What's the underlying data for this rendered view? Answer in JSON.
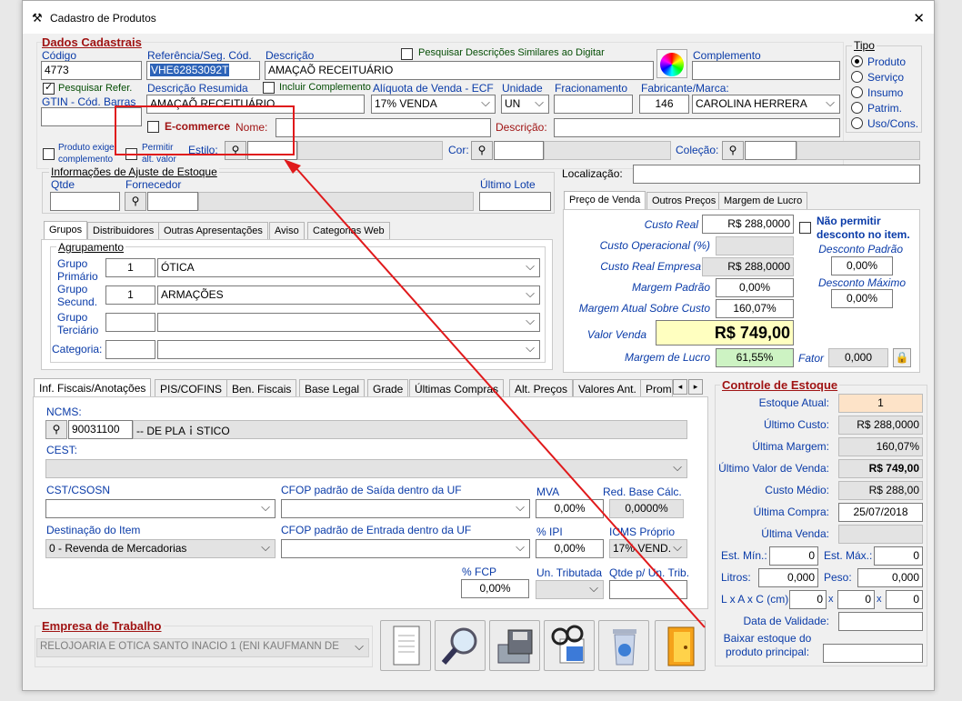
{
  "window": {
    "title": "Cadastro de Produtos",
    "close": "✕"
  },
  "dados": {
    "heading": "Dados Cadastrais",
    "codigo_label": "Código",
    "codigo": "4773",
    "ref_label": "Referência/Seg. Cód.",
    "ref": "VHE62853092T",
    "desc_label": "Descrição",
    "desc": "AMAÇAÕ RECEITUÁRIO",
    "pesq_label": "Pesquisar Descrições Similares ao Digitar",
    "compl_label": "Complemento",
    "compl": "",
    "pesqref_label": "Pesquisar Refer.",
    "gtin_label": "GTIN - Cód. Barras",
    "gtin": "",
    "descres_label": "Descrição Resumida",
    "descres": "AMAÇAÕ RECEITUÁRIO",
    "inclcompl_label": "Incluir Complemento",
    "aliq_label": "Alíquota de Venda - ECF",
    "aliq": "17% VENDA",
    "unid_label": "Unidade",
    "unid": "UN",
    "frac_label": "Fracionamento",
    "frac": "",
    "fab_label": "Fabricante/Marca:",
    "fab_code": "146",
    "fab": "CAROLINA HERRERA",
    "ecom_label": "E-commerce",
    "nome_label": "Nome:",
    "nome": "",
    "desc2_label": "Descrição:",
    "desc2": "",
    "prodexige_label": "Produto exige complemento",
    "permitir_label": "Permitir alt. valor",
    "estilo_label": "Estilo:",
    "cor_label": "Cor:",
    "colecao_label": "Coleção:",
    "tipo_label": "Tipo",
    "tipos": [
      "Produto",
      "Serviço",
      "Insumo",
      "Patrim.",
      "Uso/Cons."
    ],
    "localizacao_label": "Localização:",
    "localizacao": ""
  },
  "ajuste": {
    "heading": "Informações de Ajuste de Estoque",
    "qtde_label": "Qtde",
    "forn_label": "Fornecedor",
    "lote_label": "Último Lote"
  },
  "grupos": {
    "tabs": [
      "Grupos",
      "Distribuidores",
      "Outras Apresentações",
      "Aviso",
      "Categorias Web"
    ],
    "agrup_label": "Agrupamento",
    "primario_label": "Grupo Primário",
    "primario_code": "1",
    "primario": "ÓTICA",
    "secund_label": "Grupo Secund.",
    "secund_code": "1",
    "secund": "ARMAÇÕES",
    "terciario_label": "Grupo Terciário",
    "categoria_label": "Categoria:"
  },
  "preco": {
    "tabs": [
      "Preço de Venda",
      "Outros Preços",
      "Margem de Lucro"
    ],
    "custo_real_label": "Custo Real",
    "custo_real": "R$ 288,0000",
    "custo_op_label": "Custo Operacional (%)",
    "custo_op": "",
    "custo_emp_label": "Custo Real Empresa",
    "custo_emp": "R$ 288,0000",
    "margem_pad_label": "Margem Padrão",
    "margem_pad": "0,00%",
    "margem_atual_label": "Margem Atual Sobre Custo",
    "margem_atual": "160,07%",
    "valor_venda_label": "Valor Venda",
    "valor_venda": "R$ 749,00",
    "margem_lucro_label": "Margem de Lucro",
    "margem_lucro": "61,55%",
    "fator_label": "Fator",
    "fator": "0,000",
    "nao_permitir_label": "Não permitir desconto no item.",
    "desc_pad_label": "Desconto Padrão",
    "desc_pad": "0,00%",
    "desc_max_label": "Desconto Máximo",
    "desc_max": "0,00%"
  },
  "fiscal": {
    "tabs": [
      "Inf. Fiscais/Anotações",
      "PIS/COFINS",
      "Ben. Fiscais",
      "Base Legal",
      "Grade",
      "Últimas Compras",
      "Alt. Preços",
      "Valores Ant.",
      "Prom"
    ],
    "ncm_label": "NCMS:",
    "ncm": "90031100",
    "ncm_desc": "-- DE PLAｉSTICO",
    "cest_label": "CEST:",
    "cst_label": "CST/CSOSN",
    "cfop_saida_label": "CFOP padrão de Saída dentro da UF",
    "mva_label": "MVA",
    "mva": "0,00%",
    "red_label": "Red. Base Cálc.",
    "red": "0,0000%",
    "dest_label": "Destinação do Item",
    "dest": "0 - Revenda de Mercadorias",
    "cfop_ent_label": "CFOP padrão de Entrada dentro da UF",
    "ipi_label": "% IPI",
    "ipi": "0,00%",
    "icms_label": "ICMS Próprio",
    "icms": "17% VEND.",
    "fcp_label": "% FCP",
    "fcp": "0,00%",
    "untrib_label": "Un. Tributada",
    "qtdtrib_label": "Qtde p/ Un. Trib."
  },
  "estoque": {
    "heading": "Controle de Estoque",
    "atual_label": "Estoque Atual:",
    "atual": "1",
    "ult_custo_label": "Último Custo:",
    "ult_custo": "R$ 288,0000",
    "ult_margem_label": "Última Margem:",
    "ult_margem": "160,07%",
    "ult_valor_label": "Último Valor de Venda:",
    "ult_valor": "R$ 749,00",
    "custo_medio_label": "Custo Médio:",
    "custo_medio": "R$ 288,00",
    "ult_compra_label": "Última Compra:",
    "ult_compra": "25/07/2018",
    "ult_venda_label": "Última Venda:",
    "ult_venda": "",
    "min_label": "Est. Mín.:",
    "min": "0",
    "max_label": "Est. Máx.:",
    "max": "0",
    "litros_label": "Litros:",
    "litros": "0,000",
    "peso_label": "Peso:",
    "peso": "0,000",
    "lxaxc_label": "L x A x C (cm):",
    "l": "0",
    "a": "0",
    "c": "0",
    "x": "x",
    "validade_label": "Data de Validade:",
    "baixar_label": "Baixar estoque do produto principal:"
  },
  "empresa": {
    "heading": "Empresa de Trabalho",
    "nome": "RELOJOARIA E OTICA SANTO INACIO 1  (ENI KAUFMANN DE"
  },
  "annotation": {
    "color": "#e0191b"
  }
}
